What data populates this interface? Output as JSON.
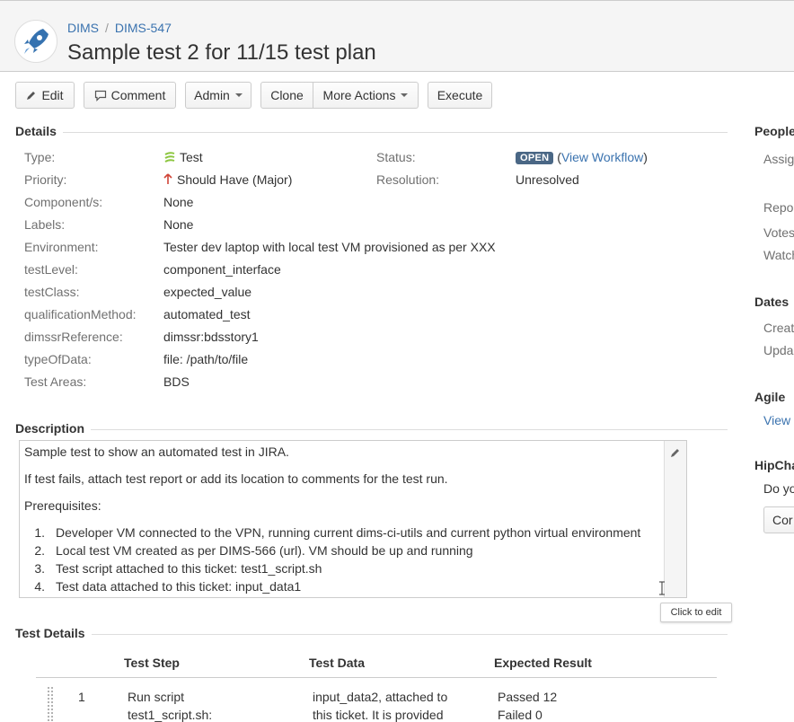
{
  "header": {
    "project": "DIMS",
    "issue_key": "DIMS-547",
    "title": "Sample test 2 for 11/15 test plan"
  },
  "toolbar": {
    "edit": "Edit",
    "comment": "Comment",
    "admin": "Admin",
    "clone": "Clone",
    "more_actions": "More Actions",
    "execute": "Execute"
  },
  "details": {
    "heading": "Details",
    "type_label": "Type:",
    "type_value": "Test",
    "priority_label": "Priority:",
    "priority_value": "Should Have (Major)",
    "components_label": "Component/s:",
    "components_value": "None",
    "labels_label": "Labels:",
    "labels_value": "None",
    "environment_label": "Environment:",
    "environment_value": "Tester dev laptop with local test VM provisioned as per XXX",
    "testlevel_label": "testLevel:",
    "testlevel_value": "component_interface",
    "testclass_label": "testClass:",
    "testclass_value": "expected_value",
    "qualification_label": "qualificationMethod:",
    "qualification_value": "automated_test",
    "dimssr_label": "dimssrReference:",
    "dimssr_value": "dimssr:bdsstory1",
    "typeofdata_label": "typeOfData:",
    "typeofdata_value": "file: /path/to/file",
    "testareas_label": "Test Areas:",
    "testareas_value": "BDS",
    "status_label": "Status:",
    "status_value": "OPEN",
    "view_workflow": "View Workflow",
    "resolution_label": "Resolution:",
    "resolution_value": "Unresolved"
  },
  "description": {
    "heading": "Description",
    "p1": "Sample test to show an automated test in JIRA.",
    "p2": "If test fails, attach test report or add its location to comments for the test run.",
    "p3": "Prerequisites:",
    "items": [
      "Developer VM connected to the VPN, running current dims-ci-utils and current python virtual environment",
      "Local test VM created as per DIMS-566 (url). VM should be up and running",
      "Test script attached to this ticket: test1_script.sh",
      "Test data attached to this ticket: input_data1"
    ],
    "tooltip": "Click to edit"
  },
  "test_details": {
    "heading": "Test Details",
    "columns": [
      "Test Step",
      "Test Data",
      "Expected Result"
    ],
    "rows": [
      {
        "num": "1",
        "step": [
          "Run script",
          "test1_script.sh:"
        ],
        "data": [
          "input_data2, attached to",
          "this ticket. It is provided"
        ],
        "expected": [
          "Passed 12",
          "Failed 0"
        ]
      }
    ]
  },
  "sidebar": {
    "people": "People",
    "assignee": "Assig",
    "reporter": "Repo",
    "votes": "Votes",
    "watchers": "Watch",
    "dates": "Dates",
    "created": "Creat",
    "updated": "Upda",
    "agile": "Agile",
    "agile_view": "View",
    "hipchat": "HipCha",
    "hipchat_text": "Do yo",
    "hipchat_button": "Cor"
  },
  "colors": {
    "link": "#3b73af",
    "status_lozenge": "#4a6785",
    "priority_arrow": "#d04437"
  }
}
